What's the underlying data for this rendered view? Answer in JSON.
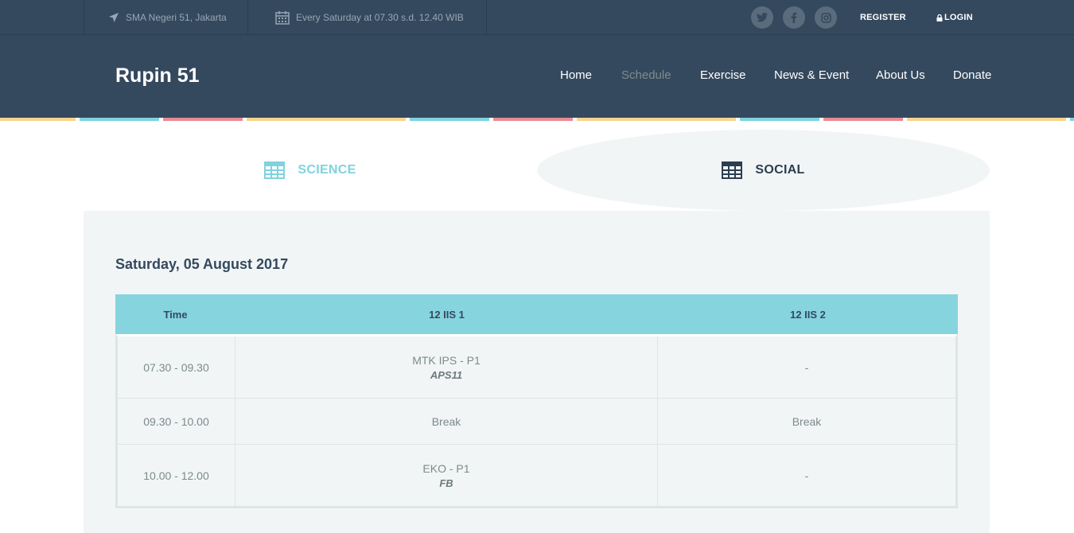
{
  "topbar": {
    "location": "SMA Negeri 51, Jakarta",
    "schedule": "Every Saturday at 07.30 s.d. 12.40 WIB",
    "social_icons": [
      "twitter-icon",
      "facebook-icon",
      "instagram-icon"
    ],
    "register": "REGISTER",
    "login": "LOGIN"
  },
  "header": {
    "brand": "Rupin 51",
    "nav": [
      "Home",
      "Schedule",
      "Exercise",
      "News & Event",
      "About Us",
      "Donate"
    ],
    "active_nav": "Schedule"
  },
  "stripe_colors": [
    "#f6d58e",
    "#7fd3df",
    "#e98a94"
  ],
  "tabs": {
    "science": "SCIENCE",
    "social": "SOCIAL",
    "active": "SCIENCE"
  },
  "schedule": {
    "date": "Saturday, 05 August 2017",
    "headers": [
      "Time",
      "12 IIS 1",
      "12 IIS 2"
    ],
    "rows": [
      {
        "time": "07.30 - 09.30",
        "c1_subject": "MTK IPS - P1",
        "c1_teacher": "APS11",
        "c2_subject": "-"
      },
      {
        "time": "09.30 - 10.00",
        "c1_subject": "Break",
        "c1_teacher": "",
        "c2_subject": "Break"
      },
      {
        "time": "10.00 - 12.00",
        "c1_subject": "EKO - P1",
        "c1_teacher": "FB",
        "c2_subject": "-"
      }
    ]
  },
  "colors": {
    "header_bg": "#34495e",
    "accent": "#86d4de",
    "panel_bg": "#f2f5f6"
  }
}
